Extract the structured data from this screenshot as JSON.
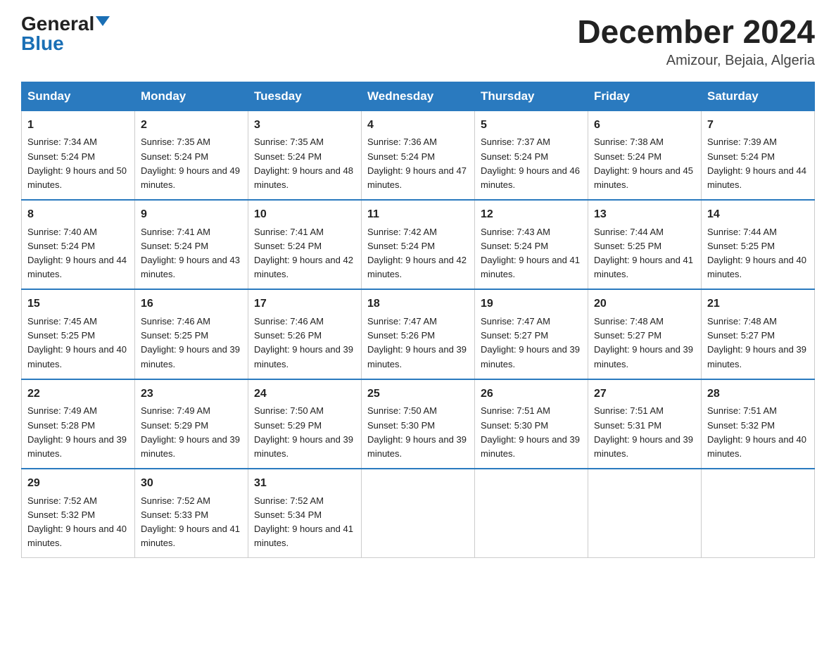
{
  "header": {
    "logo_general": "General",
    "logo_blue": "Blue",
    "month_title": "December 2024",
    "location": "Amizour, Bejaia, Algeria"
  },
  "days_of_week": [
    "Sunday",
    "Monday",
    "Tuesday",
    "Wednesday",
    "Thursday",
    "Friday",
    "Saturday"
  ],
  "weeks": [
    [
      {
        "day": "1",
        "sunrise": "7:34 AM",
        "sunset": "5:24 PM",
        "daylight": "9 hours and 50 minutes."
      },
      {
        "day": "2",
        "sunrise": "7:35 AM",
        "sunset": "5:24 PM",
        "daylight": "9 hours and 49 minutes."
      },
      {
        "day": "3",
        "sunrise": "7:35 AM",
        "sunset": "5:24 PM",
        "daylight": "9 hours and 48 minutes."
      },
      {
        "day": "4",
        "sunrise": "7:36 AM",
        "sunset": "5:24 PM",
        "daylight": "9 hours and 47 minutes."
      },
      {
        "day": "5",
        "sunrise": "7:37 AM",
        "sunset": "5:24 PM",
        "daylight": "9 hours and 46 minutes."
      },
      {
        "day": "6",
        "sunrise": "7:38 AM",
        "sunset": "5:24 PM",
        "daylight": "9 hours and 45 minutes."
      },
      {
        "day": "7",
        "sunrise": "7:39 AM",
        "sunset": "5:24 PM",
        "daylight": "9 hours and 44 minutes."
      }
    ],
    [
      {
        "day": "8",
        "sunrise": "7:40 AM",
        "sunset": "5:24 PM",
        "daylight": "9 hours and 44 minutes."
      },
      {
        "day": "9",
        "sunrise": "7:41 AM",
        "sunset": "5:24 PM",
        "daylight": "9 hours and 43 minutes."
      },
      {
        "day": "10",
        "sunrise": "7:41 AM",
        "sunset": "5:24 PM",
        "daylight": "9 hours and 42 minutes."
      },
      {
        "day": "11",
        "sunrise": "7:42 AM",
        "sunset": "5:24 PM",
        "daylight": "9 hours and 42 minutes."
      },
      {
        "day": "12",
        "sunrise": "7:43 AM",
        "sunset": "5:24 PM",
        "daylight": "9 hours and 41 minutes."
      },
      {
        "day": "13",
        "sunrise": "7:44 AM",
        "sunset": "5:25 PM",
        "daylight": "9 hours and 41 minutes."
      },
      {
        "day": "14",
        "sunrise": "7:44 AM",
        "sunset": "5:25 PM",
        "daylight": "9 hours and 40 minutes."
      }
    ],
    [
      {
        "day": "15",
        "sunrise": "7:45 AM",
        "sunset": "5:25 PM",
        "daylight": "9 hours and 40 minutes."
      },
      {
        "day": "16",
        "sunrise": "7:46 AM",
        "sunset": "5:25 PM",
        "daylight": "9 hours and 39 minutes."
      },
      {
        "day": "17",
        "sunrise": "7:46 AM",
        "sunset": "5:26 PM",
        "daylight": "9 hours and 39 minutes."
      },
      {
        "day": "18",
        "sunrise": "7:47 AM",
        "sunset": "5:26 PM",
        "daylight": "9 hours and 39 minutes."
      },
      {
        "day": "19",
        "sunrise": "7:47 AM",
        "sunset": "5:27 PM",
        "daylight": "9 hours and 39 minutes."
      },
      {
        "day": "20",
        "sunrise": "7:48 AM",
        "sunset": "5:27 PM",
        "daylight": "9 hours and 39 minutes."
      },
      {
        "day": "21",
        "sunrise": "7:48 AM",
        "sunset": "5:27 PM",
        "daylight": "9 hours and 39 minutes."
      }
    ],
    [
      {
        "day": "22",
        "sunrise": "7:49 AM",
        "sunset": "5:28 PM",
        "daylight": "9 hours and 39 minutes."
      },
      {
        "day": "23",
        "sunrise": "7:49 AM",
        "sunset": "5:29 PM",
        "daylight": "9 hours and 39 minutes."
      },
      {
        "day": "24",
        "sunrise": "7:50 AM",
        "sunset": "5:29 PM",
        "daylight": "9 hours and 39 minutes."
      },
      {
        "day": "25",
        "sunrise": "7:50 AM",
        "sunset": "5:30 PM",
        "daylight": "9 hours and 39 minutes."
      },
      {
        "day": "26",
        "sunrise": "7:51 AM",
        "sunset": "5:30 PM",
        "daylight": "9 hours and 39 minutes."
      },
      {
        "day": "27",
        "sunrise": "7:51 AM",
        "sunset": "5:31 PM",
        "daylight": "9 hours and 39 minutes."
      },
      {
        "day": "28",
        "sunrise": "7:51 AM",
        "sunset": "5:32 PM",
        "daylight": "9 hours and 40 minutes."
      }
    ],
    [
      {
        "day": "29",
        "sunrise": "7:52 AM",
        "sunset": "5:32 PM",
        "daylight": "9 hours and 40 minutes."
      },
      {
        "day": "30",
        "sunrise": "7:52 AM",
        "sunset": "5:33 PM",
        "daylight": "9 hours and 41 minutes."
      },
      {
        "day": "31",
        "sunrise": "7:52 AM",
        "sunset": "5:34 PM",
        "daylight": "9 hours and 41 minutes."
      },
      null,
      null,
      null,
      null
    ]
  ]
}
